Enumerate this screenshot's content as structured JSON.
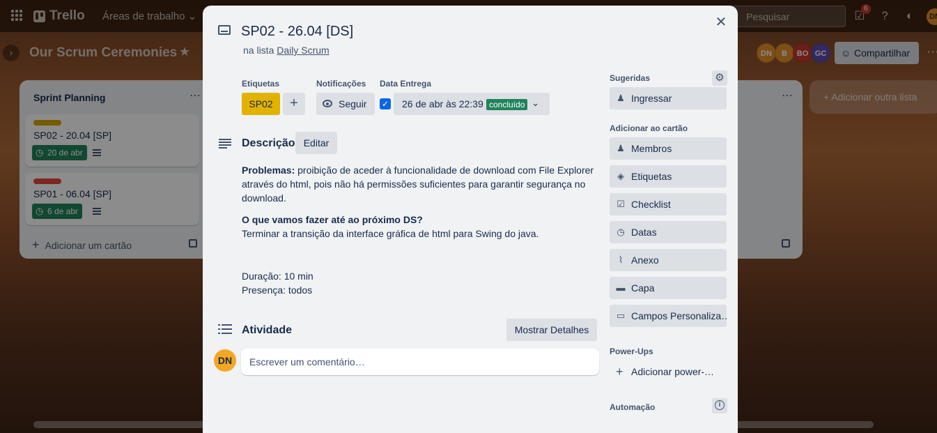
{
  "topbar": {
    "logo": "Trello",
    "workspaces_label": "Áreas de trabalho",
    "search_placeholder": "Pesquisar",
    "notification_count": "6",
    "user_initials": "DN"
  },
  "board": {
    "title": "Our Scrum Ceremonies",
    "members": [
      {
        "initials": "DN",
        "color": "#e3902b"
      },
      {
        "initials": "B",
        "color": "#e3902b"
      },
      {
        "initials": "BO",
        "color": "#c9372c"
      },
      {
        "initials": "GC",
        "color": "#5e4db2"
      }
    ],
    "share_label": "Compartilhar",
    "add_list_label": "Adicionar outra lista",
    "lists": [
      {
        "title": "Sprint Planning",
        "cards": [
          {
            "title": "SP02 - 20.04 [SP]",
            "label_color": "#d6a603",
            "due": "20 de abr"
          },
          {
            "title": "SP01 - 06.04 [SP]",
            "label_color": "#e2483d",
            "due": "6 de abr"
          }
        ],
        "add_card_label": "Adicionar um cartão"
      }
    ]
  },
  "modal": {
    "title": "SP02 - 26.04 [DS]",
    "in_list_prefix": "na lista",
    "list_name": "Daily Scrum",
    "labels_heading": "Etiquetas",
    "label_chip": "SP02",
    "label_color": "#e2b203",
    "notifications_heading": "Notificações",
    "watch_label": "Seguir",
    "due_heading": "Data Entrega",
    "due_text": "26 de abr às 22:39",
    "due_status": "concluído",
    "due_checked": true,
    "description_heading": "Descrição",
    "edit_label": "Editar",
    "description": {
      "problems_label": "Problemas:",
      "problems_text": "proibição de aceder à funcionalidade de download com File Explorer através do html, pois não há permissões suficientes para garantir segurança no download.",
      "next_heading": "O que vamos fazer até ao próximo DS?",
      "next_text": "Terminar a transição da interface gráfica de html para Swing do java.",
      "duration": "Duração: 10 min",
      "presence": "Presença: todos"
    },
    "activity_heading": "Atividade",
    "show_details_label": "Mostrar Detalhes",
    "commenter_initials": "DN",
    "comment_placeholder": "Escrever um comentário…",
    "sidebar": {
      "suggested_heading": "Sugeridas",
      "join_label": "Ingressar",
      "add_to_card_heading": "Adicionar ao cartão",
      "buttons": [
        "Membros",
        "Etiquetas",
        "Checklist",
        "Datas",
        "Anexo",
        "Capa",
        "Campos Personaliza…"
      ],
      "powerups_heading": "Power-Ups",
      "add_powerup_label": "Adicionar power-…",
      "automation_heading": "Automação"
    }
  }
}
